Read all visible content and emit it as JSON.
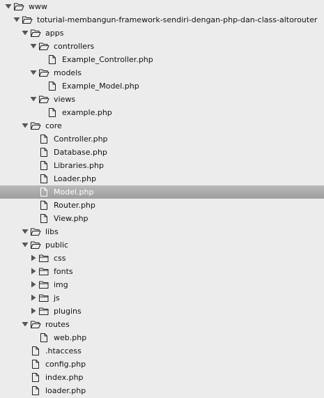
{
  "tree": [
    {
      "label": "www",
      "type": "folder",
      "state": "expanded",
      "depth": 0
    },
    {
      "label": "toturial-membangun-framework-sendiri-dengan-php-dan-class-altorouter",
      "type": "folder",
      "state": "expanded",
      "depth": 1
    },
    {
      "label": "apps",
      "type": "folder",
      "state": "expanded",
      "depth": 2
    },
    {
      "label": "controllers",
      "type": "folder",
      "state": "expanded",
      "depth": 3
    },
    {
      "label": "Example_Controller.php",
      "type": "file",
      "depth": 4
    },
    {
      "label": "models",
      "type": "folder",
      "state": "expanded",
      "depth": 3
    },
    {
      "label": "Example_Model.php",
      "type": "file",
      "depth": 4
    },
    {
      "label": "views",
      "type": "folder",
      "state": "expanded",
      "depth": 3
    },
    {
      "label": "example.php",
      "type": "file",
      "depth": 4
    },
    {
      "label": "core",
      "type": "folder",
      "state": "expanded",
      "depth": 2
    },
    {
      "label": "Controller.php",
      "type": "file",
      "depth": 3
    },
    {
      "label": "Database.php",
      "type": "file",
      "depth": 3
    },
    {
      "label": "Libraries.php",
      "type": "file",
      "depth": 3
    },
    {
      "label": "Loader.php",
      "type": "file",
      "depth": 3
    },
    {
      "label": "Model.php",
      "type": "file",
      "depth": 3,
      "selected": true
    },
    {
      "label": "Router.php",
      "type": "file",
      "depth": 3
    },
    {
      "label": "View.php",
      "type": "file",
      "depth": 3
    },
    {
      "label": "libs",
      "type": "folder",
      "state": "expanded",
      "depth": 2
    },
    {
      "label": "public",
      "type": "folder",
      "state": "expanded",
      "depth": 2
    },
    {
      "label": "css",
      "type": "folder",
      "state": "collapsed",
      "depth": 3
    },
    {
      "label": "fonts",
      "type": "folder",
      "state": "collapsed",
      "depth": 3
    },
    {
      "label": "img",
      "type": "folder",
      "state": "collapsed",
      "depth": 3
    },
    {
      "label": "js",
      "type": "folder",
      "state": "collapsed",
      "depth": 3
    },
    {
      "label": "plugins",
      "type": "folder",
      "state": "collapsed",
      "depth": 3
    },
    {
      "label": "routes",
      "type": "folder",
      "state": "expanded",
      "depth": 2
    },
    {
      "label": "web.php",
      "type": "file",
      "depth": 3
    },
    {
      "label": ".htaccess",
      "type": "file",
      "depth": 2
    },
    {
      "label": "config.php",
      "type": "file",
      "depth": 2
    },
    {
      "label": "index.php",
      "type": "file",
      "depth": 2
    },
    {
      "label": "loader.php",
      "type": "file",
      "depth": 2
    }
  ],
  "colors": {
    "background": "#ececec",
    "selected_row": "#a8a8a8",
    "selected_text": "#ffffff",
    "icon_stroke": "#222222",
    "arrow_fill": "#555555"
  }
}
